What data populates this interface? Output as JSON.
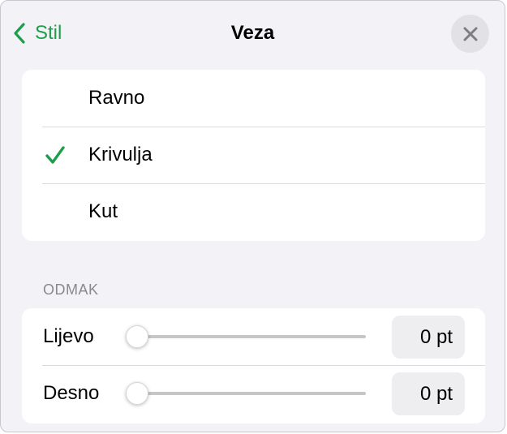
{
  "header": {
    "back_label": "Stil",
    "title": "Veza"
  },
  "colors": {
    "accent": "#1e9e4a",
    "background": "#f2f2f7"
  },
  "line_styles": {
    "selected_index": 1,
    "items": [
      {
        "label": "Ravno",
        "selected": false
      },
      {
        "label": "Krivulja",
        "selected": true
      },
      {
        "label": "Kut",
        "selected": false
      }
    ]
  },
  "offset": {
    "section_title": "ODMAK",
    "rows": [
      {
        "label": "Lijevo",
        "value": "0 pt",
        "slider_fraction": 0
      },
      {
        "label": "Desno",
        "value": "0 pt",
        "slider_fraction": 0
      }
    ]
  },
  "icons": {
    "back": "chevron-left-icon",
    "close": "close-icon",
    "check": "checkmark-icon"
  }
}
